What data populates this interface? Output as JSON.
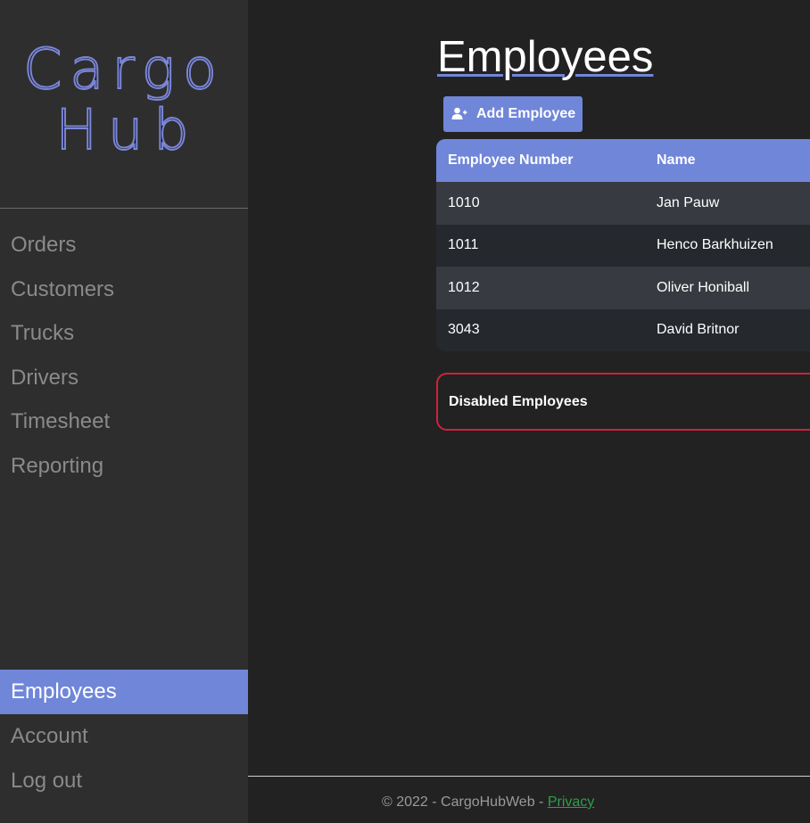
{
  "brand": {
    "line1": "Cargo",
    "line2": "Hub"
  },
  "sidebar": {
    "top_items": [
      {
        "label": "Orders"
      },
      {
        "label": "Customers"
      },
      {
        "label": "Trucks"
      },
      {
        "label": "Drivers"
      },
      {
        "label": "Timesheet"
      },
      {
        "label": "Reporting"
      }
    ],
    "bottom_items": [
      {
        "label": "Employees",
        "active": true
      },
      {
        "label": "Account"
      },
      {
        "label": "Log out"
      }
    ]
  },
  "main": {
    "title": "Employees",
    "add_button": {
      "label": "Add Employee",
      "icon": "user-plus-icon"
    },
    "table": {
      "columns": [
        "Employee Number",
        "Name"
      ],
      "rows": [
        {
          "number": "1010",
          "name": "Jan Pauw"
        },
        {
          "number": "1011",
          "name": "Henco Barkhuizen"
        },
        {
          "number": "1012",
          "name": "Oliver Honiball"
        },
        {
          "number": "3043",
          "name": "David Britnor"
        }
      ]
    },
    "disabled_section": {
      "label": "Disabled Employees"
    }
  },
  "footer": {
    "text": "© 2022 - CargoHubWeb - ",
    "privacy_link": "Privacy"
  },
  "colors": {
    "accent": "#7086d8",
    "danger": "#d0213f",
    "link": "#2f9e4a",
    "background": "#222222",
    "sidebar": "#2e2e2e"
  }
}
